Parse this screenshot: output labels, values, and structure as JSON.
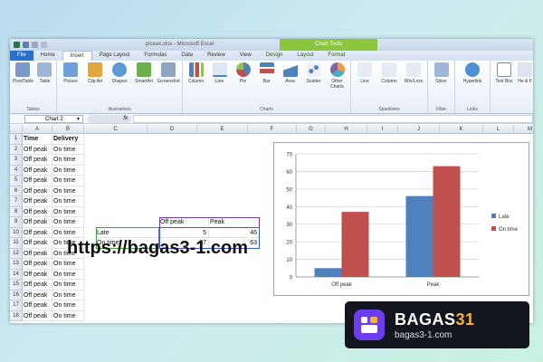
{
  "window": {
    "title": "piceax.xlsx - Microsoft Excel",
    "context_group": "Chart Tools"
  },
  "tabs": [
    "File",
    "Home",
    "Insert",
    "Page Layout",
    "Formulas",
    "Data",
    "Review",
    "View",
    "Design",
    "Layout",
    "Format"
  ],
  "active_tab": "Insert",
  "ribbon": {
    "groups": [
      {
        "label": "Tables",
        "buttons": [
          "PivotTable",
          "Table"
        ]
      },
      {
        "label": "Illustrations",
        "buttons": [
          "Picture",
          "Clip Art",
          "Shapes",
          "SmartArt",
          "Screenshot"
        ]
      },
      {
        "label": "Charts",
        "buttons": [
          "Column",
          "Line",
          "Pie",
          "Bar",
          "Area",
          "Scatter",
          "Other Charts"
        ]
      },
      {
        "label": "Sparklines",
        "buttons": [
          "Line",
          "Column",
          "Win/Loss"
        ]
      },
      {
        "label": "Filter",
        "buttons": [
          "Slicer"
        ]
      },
      {
        "label": "Links",
        "buttons": [
          "Hyperlink"
        ]
      },
      {
        "label": "",
        "buttons": [
          "Text Box",
          "He & F"
        ]
      }
    ]
  },
  "formula_bar": {
    "name_box": "Chart 2",
    "fx": "fx",
    "formula": ""
  },
  "columns": [
    "A",
    "B",
    "C",
    "D",
    "E",
    "F",
    "G",
    "H",
    "I",
    "J",
    "K",
    "L",
    "M"
  ],
  "rows": [
    "1",
    "2",
    "3",
    "4",
    "5",
    "6",
    "7",
    "8",
    "9",
    "10",
    "11",
    "12",
    "13",
    "14",
    "15",
    "16",
    "17",
    "18"
  ],
  "sheet": {
    "col_a": [
      "Time",
      "Off peak",
      "Off peak",
      "Off peak",
      "Off peak",
      "Off peak",
      "Off peak",
      "Off peak",
      "Off peak",
      "Off peak",
      "Off peak",
      "Off peak",
      "Off peak",
      "Off peak",
      "Off peak",
      "Off peak",
      "Off peak",
      "Off peak"
    ],
    "col_b": [
      "Delivery",
      "On time",
      "On time",
      "On time",
      "On time",
      "On time",
      "On time",
      "On time",
      "On time",
      "On time",
      "On time",
      "On time",
      "On time",
      "On time",
      "On time",
      "On time",
      "On time",
      "On time"
    ],
    "summary": {
      "hdr_d": "Off peak",
      "hdr_e": "Peak",
      "row_late": "Late",
      "row_ontime": "On time",
      "late_offpeak": "5",
      "late_peak": "46",
      "ontime_offpeak": "37",
      "ontime_peak": "63"
    }
  },
  "chart_data": {
    "type": "bar",
    "categories": [
      "Off peak",
      "Peak"
    ],
    "series": [
      {
        "name": "Late",
        "values": [
          5,
          46
        ],
        "color": "#4f81bd"
      },
      {
        "name": "On time",
        "values": [
          37,
          63
        ],
        "color": "#c0504d"
      }
    ],
    "ylim": [
      0,
      70
    ],
    "yticks": [
      "0",
      "10",
      "20",
      "30",
      "40",
      "50",
      "60",
      "70"
    ],
    "title": "",
    "xlabel": "",
    "ylabel": "",
    "grid": true,
    "legend_position": "right"
  },
  "watermark_url": "https://bagas3-1.com",
  "brand": {
    "name_main": "BAGAS",
    "name_accent": "31",
    "url": "bagas3-1.com"
  }
}
